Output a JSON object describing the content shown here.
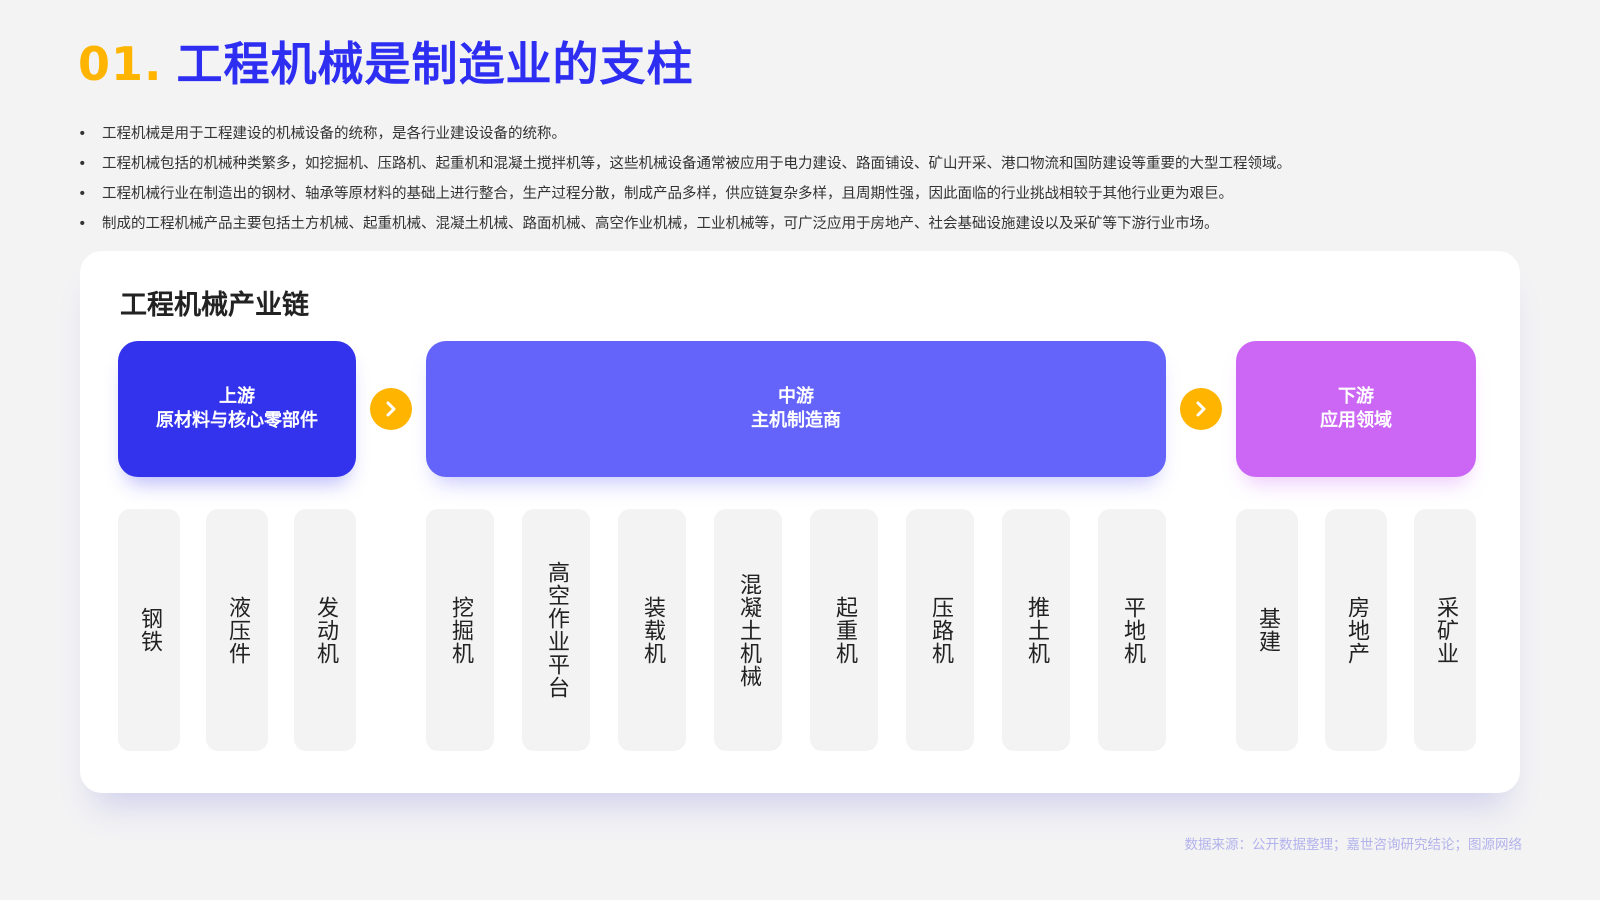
{
  "title": {
    "number": "01.",
    "text": "工程机械是制造业的支柱"
  },
  "bullets": [
    "工程机械是用于工程建设的机械设备的统称，是各行业建设设备的统称。",
    "工程机械包括的机械种类繁多，如挖掘机、压路机、起重机和混凝土搅拌机等，这些机械设备通常被应用于电力建设、路面铺设、矿山开采、港口物流和国防建设等重要的大型工程领域。",
    "工程机械行业在制造出的钢材、轴承等原材料的基础上进行整合，生产过程分散，制成产品多样，供应链复杂多样，且周期性强，因此面临的行业挑战相较于其他行业更为艰巨。",
    "制成的工程机械产品主要包括土方机械、起重机械、混凝土机械、路面机械、高空作业机械，工业机械等，可广泛应用于房地产、社会基础设施建设以及采矿等下游行业市场。"
  ],
  "chain": {
    "title": "工程机械产业链",
    "upstream": {
      "label": "上游",
      "desc": "原材料与核心零部件",
      "color": "#3333ee",
      "items": [
        "钢铁",
        "液压件",
        "发动机"
      ]
    },
    "midstream": {
      "label": "中游",
      "desc": "主机制造商",
      "color": "#6464fb",
      "items": [
        "挖掘机",
        "高空作业平台",
        "装载机",
        "混凝土机械",
        "起重机",
        "压路机",
        "推土机",
        "平地机"
      ]
    },
    "downstream": {
      "label": "下游",
      "desc": "应用领域",
      "color": "#cc66f5",
      "items": [
        "基建",
        "房地产",
        "采矿业"
      ]
    },
    "arrow_color": "#ffb400"
  },
  "source": "数据来源：公开数据整理；嘉世咨询研究结论；图源网络"
}
